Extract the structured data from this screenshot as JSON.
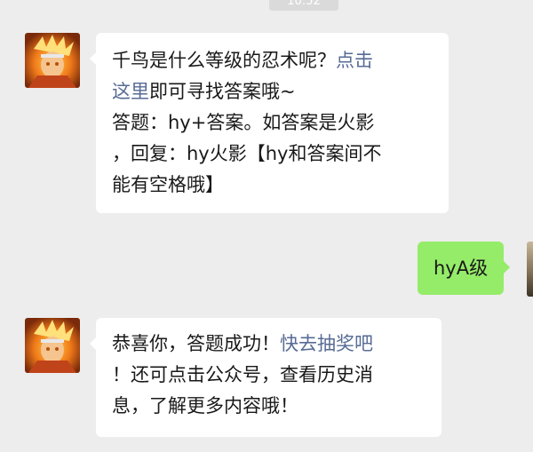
{
  "chat": {
    "timestamp": "10:52",
    "messages": [
      {
        "lines": [
          {
            "text": "千鸟是什么等级的忍术呢？",
            "link": "点击"
          },
          {
            "link": "这里",
            "text": "即可寻找答案哦~"
          },
          {
            "text": "答题：hy+答案。如答案是火影"
          },
          {
            "text": "，回复：hy火影【hy和答案间不"
          },
          {
            "text": "能有空格哦】"
          }
        ]
      },
      {
        "text": "hyA级"
      },
      {
        "lines": [
          {
            "text": "恭喜你，答题成功！",
            "link": "快去抽奖吧"
          },
          {
            "text": "！还可点击公众号，查看历史消"
          },
          {
            "text": "息，了解更多内容哦！"
          }
        ]
      }
    ]
  }
}
